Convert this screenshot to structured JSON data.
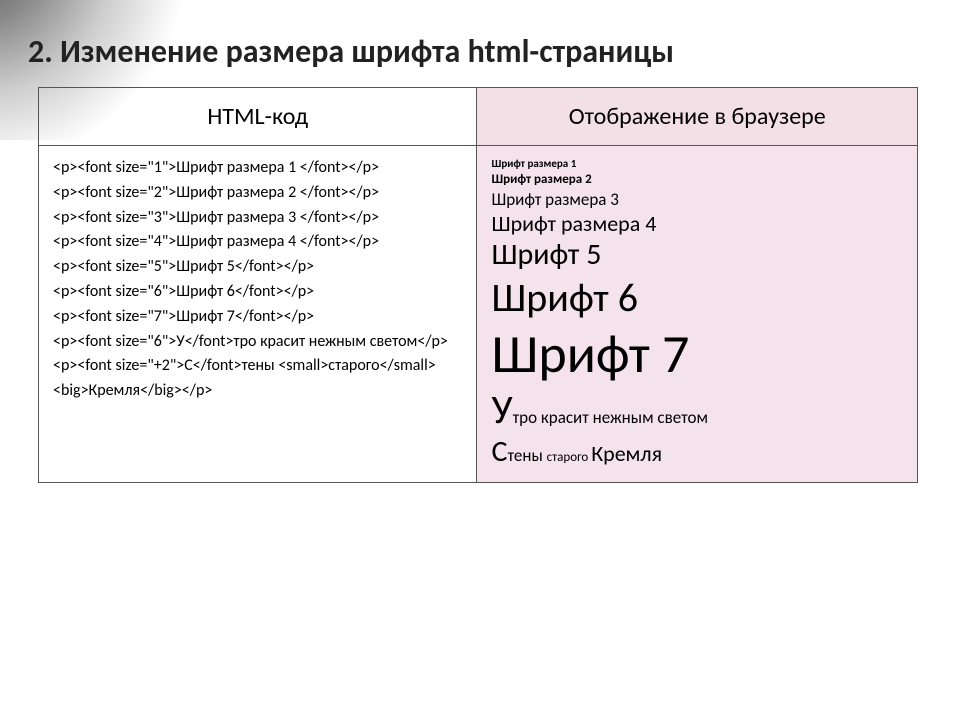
{
  "title": "2. Изменение размера шрифта html-страницы",
  "headers": {
    "code": "HTML-код",
    "render": "Отображение в браузере"
  },
  "code_lines": [
    "<p><font size=\"1\">Шрифт размера 1 </font></p>",
    "<p><font size=\"2\">Шрифт размера 2 </font></p>",
    "<p><font size=\"3\">Шрифт размера 3 </font></p>",
    "<p><font size=\"4\">Шрифт размера 4 </font></p>",
    "<p><font size=\"5\">Шрифт 5</font></p>",
    "<p><font size=\"6\">Шрифт 6</font></p>",
    "<p><font size=\"7\">Шрифт 7</font></p>",
    "<p><font size=\"6\">У</font>тро красит нежным светом</p>",
    "<p><font size=\"+2\">С</font>тены <small>старого</small> <big>Кремля</big></p>"
  ],
  "render": {
    "l1": "Шрифт размера 1",
    "l2": "Шрифт размера  2",
    "l3": "Шрифт размера 3",
    "l4": "Шрифт размера 4",
    "l5": "Шрифт 5",
    "l6": "Шрифт 6",
    "l7": "Шрифт 7",
    "l8_drop": "У",
    "l8_rest": "тро красит нежным светом",
    "l9_drop": "С",
    "l9_a": "тены ",
    "l9_small": "старого ",
    "l9_big": "Кремля"
  }
}
